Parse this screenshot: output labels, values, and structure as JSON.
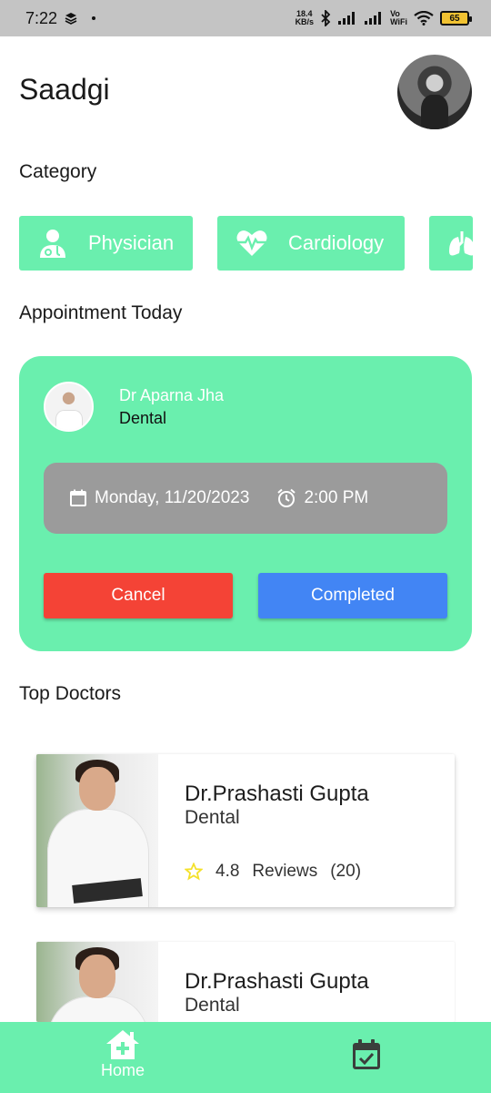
{
  "status_bar": {
    "time": "7:22",
    "net_speed_value": "18.4",
    "net_speed_unit": "KB/s",
    "vowifi_top": "Vo",
    "vowifi_bottom": "WiFi",
    "battery": "65"
  },
  "header": {
    "title": "Saadgi"
  },
  "category": {
    "title": "Category",
    "items": [
      {
        "label": "Physician",
        "icon": "doctor-icon"
      },
      {
        "label": "Cardiology",
        "icon": "heartbeat-icon"
      },
      {
        "label": "",
        "icon": "lungs-icon"
      }
    ]
  },
  "appointment": {
    "title": "Appointment Today",
    "doctor_name": "Dr Aparna Jha",
    "specialty": "Dental",
    "date": "Monday, 11/20/2023",
    "time": "2:00 PM",
    "cancel_label": "Cancel",
    "completed_label": "Completed"
  },
  "top_doctors": {
    "title": "Top Doctors",
    "items": [
      {
        "name": "Dr.Prashasti Gupta",
        "specialty": "Dental",
        "rating": "4.8",
        "reviews_label": "Reviews",
        "reviews_count": "(20)"
      },
      {
        "name": "Dr.Prashasti Gupta",
        "specialty": "Dental"
      }
    ]
  },
  "bottom_nav": {
    "home_label": "Home"
  },
  "colors": {
    "accent_green": "#6aefae",
    "cancel_red": "#f44336",
    "completed_blue": "#4285f4",
    "star_yellow": "#f4e12a"
  }
}
